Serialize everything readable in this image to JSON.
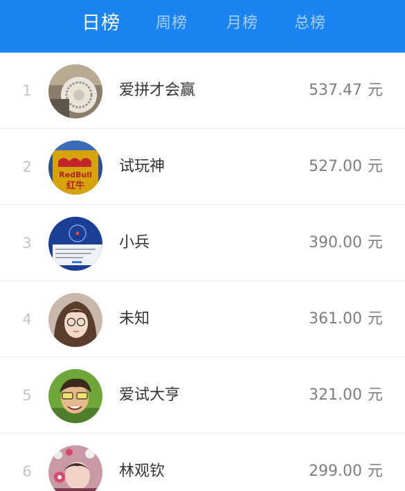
{
  "tabs": [
    {
      "label": "日榜",
      "active": true
    },
    {
      "label": "周榜",
      "active": false
    },
    {
      "label": "月榜",
      "active": false
    },
    {
      "label": "总榜",
      "active": false
    }
  ],
  "ranking": [
    {
      "rank": "1",
      "name": "爱拼才会赢",
      "amount": "537.47",
      "unit": "元"
    },
    {
      "rank": "2",
      "name": "试玩神",
      "amount": "527.00",
      "unit": "元"
    },
    {
      "rank": "3",
      "name": "小兵",
      "amount": "390.00",
      "unit": "元"
    },
    {
      "rank": "4",
      "name": "未知",
      "amount": "361.00",
      "unit": "元"
    },
    {
      "rank": "5",
      "name": "爱试大亨",
      "amount": "321.00",
      "unit": "元"
    },
    {
      "rank": "6",
      "name": "林观钦",
      "amount": "299.00",
      "unit": "元"
    }
  ],
  "avatar_2_text": {
    "line1": "RedBull",
    "line2": "红牛"
  },
  "colors": {
    "header": "#1a84f3",
    "rank": "#c4c4c4",
    "name": "#333333",
    "amount": "#7d7d7d"
  }
}
